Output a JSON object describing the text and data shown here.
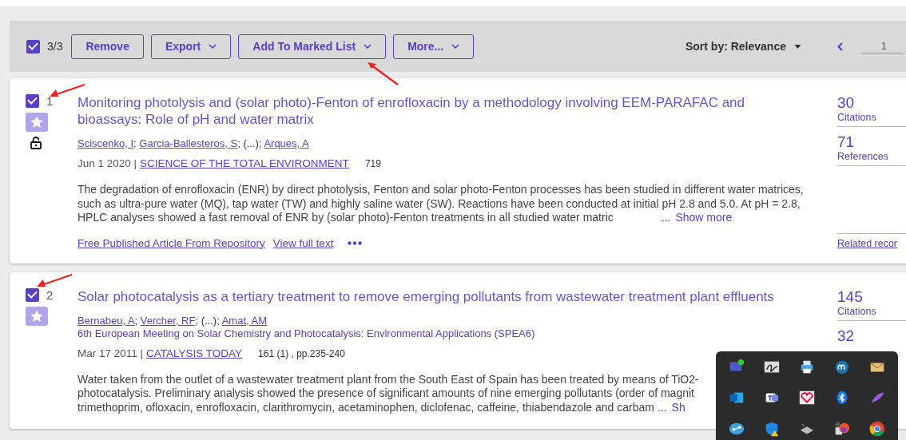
{
  "toolbar": {
    "select_all": {
      "checked": true
    },
    "count": "3/3",
    "buttons": [
      {
        "label": "Remove",
        "dropdown": false
      },
      {
        "label": "Export",
        "dropdown": true
      },
      {
        "label": "Add To Marked List",
        "dropdown": true
      },
      {
        "label": "More...",
        "dropdown": true
      }
    ],
    "sort": "Sort by: Relevance",
    "page": "1"
  },
  "records": [
    {
      "checked": true,
      "number": "1",
      "open_access": true,
      "title": "Monitoring photolysis and (solar photo)-Fenton of enrofloxacin by a methodology involving EEM-PARAFAC and bioassays: Role of pH and water matrix",
      "authors": [
        {
          "text": "Sciscenko, I",
          "link": true
        },
        {
          "text": "; ",
          "link": false
        },
        {
          "text": "Garcia-Ballesteros, S",
          "link": true
        },
        {
          "text": "; (...); ",
          "link": false
        },
        {
          "text": "Arques, A",
          "link": true
        }
      ],
      "date": "Jun 1 2020 |",
      "journal": "SCIENCE OF THE TOTAL ENVIRONMENT",
      "volume": "719",
      "abstract_lines": [
        "The degradation of enrofloxacin (ENR) by direct photolysis, Fenton and solar photo-Fenton processes has been studied in different water matrices,",
        "such as ultra-pure water (MQ), tap water (TW) and highly saline water (SW). Reactions have been conducted at initial pH 2.8 and 5.0. At pH = 2.8,",
        "HPLC analyses showed a fast removal of ENR by (solar photo)-Fenton treatments in all studied water matric"
      ],
      "ellipsis": "...",
      "show_more": "Show more",
      "links": [
        "Free Published Article From Repository",
        "View full text"
      ],
      "more_menu": true,
      "metrics": [
        {
          "value": "30",
          "label": "Citations"
        },
        {
          "value": "71",
          "label": "References"
        }
      ],
      "related": "Related recor"
    },
    {
      "checked": true,
      "number": "2",
      "open_access": false,
      "title": "Solar photocatalysis as a tertiary treatment to remove emerging pollutants from wastewater treatment plant effluents",
      "authors": [
        {
          "text": "Bernabeu, A",
          "link": true
        },
        {
          "text": "; ",
          "link": false
        },
        {
          "text": "Vercher, RF",
          "link": true
        },
        {
          "text": "; (...); ",
          "link": false
        },
        {
          "text": "Amat, AM",
          "link": true
        }
      ],
      "conference": "6th European Meeting on Solar Chemistry and Photocatalysis: Environmental Applications (SPEA6)",
      "date": "Mar 17 2011 |",
      "journal": "CATALYSIS TODAY",
      "volume": "161 (1) , pp.235-240",
      "abstract_lines": [
        "Water taken from the outlet of a wastewater treatment plant from the South East of Spain has been treated by means of TiO2-",
        "photocatalysis. Preliminary analysis showed the presence of significant amounts of nine emerging pollutants (order of magnit",
        "trimethoprim, ofloxacin, enrofloxacin, clarithromycin, acetaminophen, diclofenac, caffeine, thiabendazole and carbam"
      ],
      "ellipsis": "...",
      "show_more": "Sh",
      "more_menu": false,
      "metrics": [
        {
          "value": "145",
          "label": "Citations"
        },
        {
          "value": "32"
        }
      ]
    }
  ]
}
